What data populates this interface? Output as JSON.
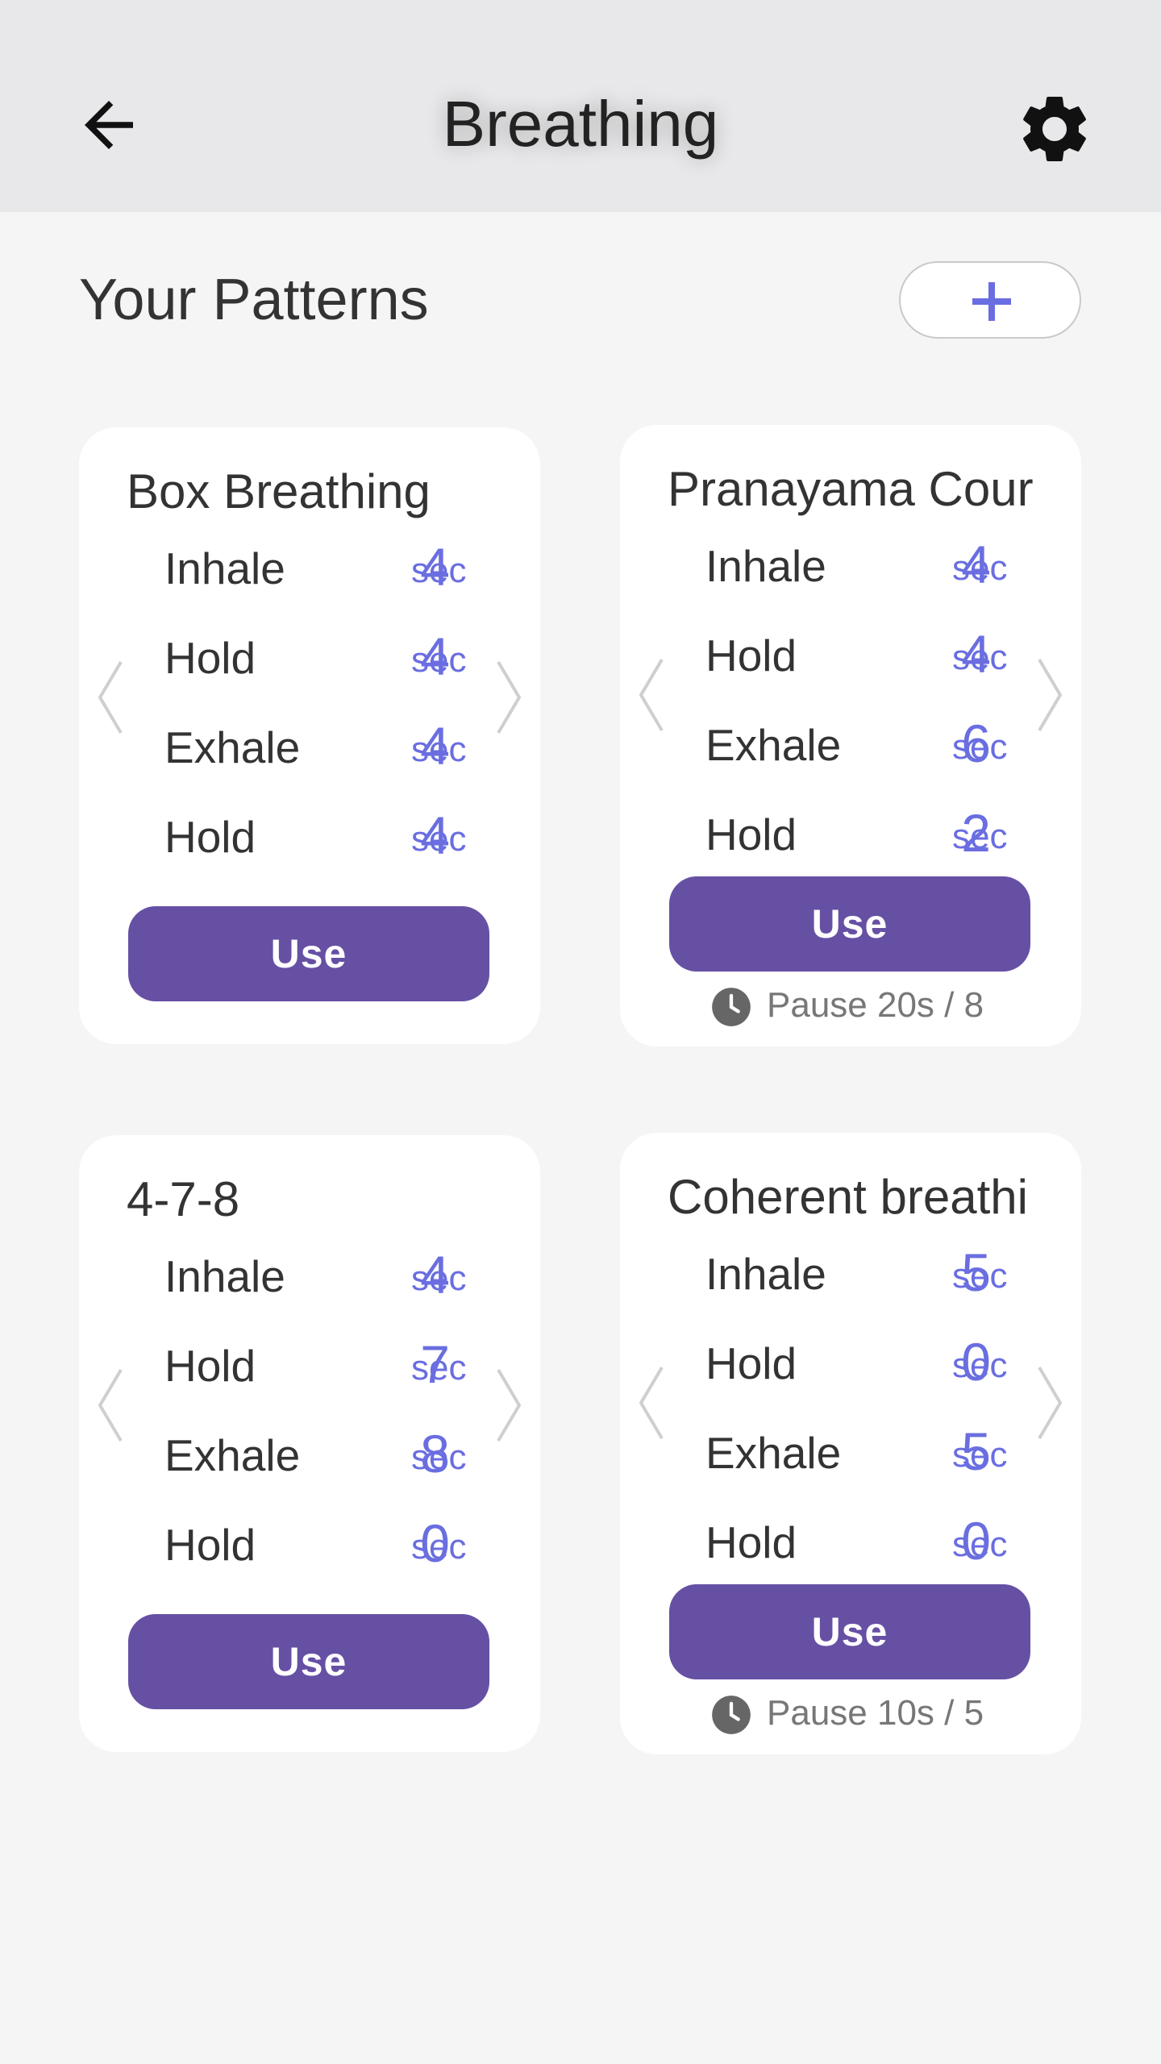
{
  "header": {
    "title": "Breathing",
    "back_icon": "arrow-left-icon",
    "settings_icon": "gear-icon"
  },
  "section": {
    "title": "Your Patterns",
    "add_icon": "plus-icon"
  },
  "colors": {
    "accent": "#6a6ee0",
    "button": "#6650a4",
    "header_bg": "#e8e8ea",
    "page_bg": "#f5f5f5"
  },
  "cards": [
    {
      "title": "Box Breathing",
      "rows": [
        {
          "label": "Inhale",
          "value": "4",
          "unit": "sec"
        },
        {
          "label": "Hold",
          "value": "4",
          "unit": "sec"
        },
        {
          "label": "Exhale",
          "value": "4",
          "unit": "sec"
        },
        {
          "label": "Hold",
          "value": "4",
          "unit": "sec"
        }
      ],
      "button": "Use",
      "pause": ""
    },
    {
      "title": "Pranayama Cour",
      "rows": [
        {
          "label": "Inhale",
          "value": "4",
          "unit": "sec"
        },
        {
          "label": "Hold",
          "value": "4",
          "unit": "sec"
        },
        {
          "label": "Exhale",
          "value": "6",
          "unit": "sec"
        },
        {
          "label": "Hold",
          "value": "2",
          "unit": "sec"
        }
      ],
      "button": "Use",
      "pause": "Pause 20s / 8"
    },
    {
      "title": "4-7-8",
      "rows": [
        {
          "label": "Inhale",
          "value": "4",
          "unit": "sec"
        },
        {
          "label": "Hold",
          "value": "7",
          "unit": "sec"
        },
        {
          "label": "Exhale",
          "value": "8",
          "unit": "sec"
        },
        {
          "label": "Hold",
          "value": "0",
          "unit": "sec"
        }
      ],
      "button": "Use",
      "pause": ""
    },
    {
      "title": "Coherent breathi",
      "rows": [
        {
          "label": "Inhale",
          "value": "5",
          "unit": "sec"
        },
        {
          "label": "Hold",
          "value": "0",
          "unit": "sec"
        },
        {
          "label": "Exhale",
          "value": "5",
          "unit": "sec"
        },
        {
          "label": "Hold",
          "value": "0",
          "unit": "sec"
        }
      ],
      "button": "Use",
      "pause": "Pause 10s / 5"
    }
  ]
}
